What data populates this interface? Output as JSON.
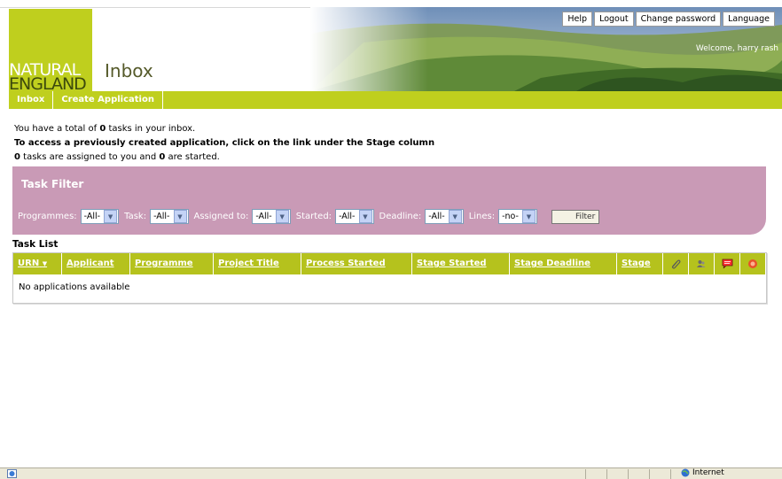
{
  "header": {
    "logo_line1": "NATURAL",
    "logo_line2": "ENGLAND",
    "title": "Inbox",
    "top_links": [
      "Help",
      "Logout",
      "Change password",
      "Language"
    ],
    "welcome": "Welcome, harry rash"
  },
  "nav": {
    "items": [
      "Inbox",
      "Create Application"
    ]
  },
  "info": {
    "line1_prefix": "You have a total of ",
    "line1_count": "0",
    "line1_suffix": " tasks in your inbox.",
    "line2": "To access a previously created application, click on the link under the Stage column",
    "line3_count1": "0",
    "line3_mid": " tasks are assigned to you and ",
    "line3_count2": "0",
    "line3_suffix": " are started."
  },
  "filter": {
    "title": "Task Filter",
    "fields": [
      {
        "label": "Programmes:",
        "value": "-All-"
      },
      {
        "label": "Task:",
        "value": "-All-"
      },
      {
        "label": "Assigned to:",
        "value": "-All-"
      },
      {
        "label": "Started:",
        "value": "-All-"
      },
      {
        "label": "Deadline:",
        "value": "-All-"
      },
      {
        "label": "Lines:",
        "value": "-no-"
      }
    ],
    "button": "Filter"
  },
  "tasklist": {
    "label": "Task List",
    "columns": [
      "URN",
      "Applicant",
      "Programme",
      "Project Title",
      "Process Started",
      "Stage Started",
      "Stage Deadline",
      "Stage"
    ],
    "icon_columns": [
      "paperclip-icon",
      "people-icon",
      "comment-icon",
      "alert-icon"
    ],
    "empty_text": "No applications available"
  },
  "statusbar": {
    "zone": "Internet"
  },
  "colors": {
    "brand_green": "#bfcf1e",
    "table_header": "#b5c21d",
    "filter_bg": "#c99ab6"
  }
}
